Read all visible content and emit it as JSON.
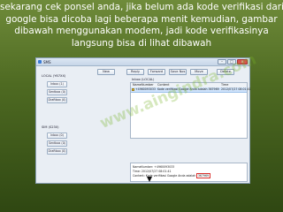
{
  "caption": {
    "line1": "sekarang cek ponsel anda, jika belum ada kode verifikasi dari",
    "line2": "google bisa dicoba lagi beberapa menit kemudian, gambar",
    "line3": "dibawah menggunakan modem, jadi kode verifikasinya",
    "line4": "langsung bisa di lihat dibawah"
  },
  "window": {
    "title": "SMS",
    "controls": {
      "min": "–",
      "max": "□",
      "close": "×"
    }
  },
  "toolbar": {
    "buttons": [
      "New",
      "Reply",
      "Forward",
      "Save Nos",
      "Move",
      "Delete"
    ]
  },
  "sidebar": {
    "local_label": "LOCAL (Y67XX)",
    "sim_label": "SIM (S230)",
    "local_items": [
      "Inbox (1)",
      "Sentbox (0)",
      "Draftbox (0)"
    ],
    "sim_items": [
      "Inbox (0)",
      "Sentbox (0)",
      "Draftbox (0)"
    ]
  },
  "inbox": {
    "label": "Inbox (LOCAL)",
    "columns": [
      "NameNumber",
      "Content",
      "Time"
    ],
    "rows": [
      {
        "number": "+4960093033",
        "content": "Kode verifikasi Google Anda adalah 367969",
        "time": "2012/07/27 08:01:41"
      }
    ]
  },
  "detail": {
    "line1": "NameNumber: +4960093033",
    "line2": "Time: 2012/07/27 08:01:41",
    "line3_prefix": "Content:   Kode verifikasi Google Anda adalah ",
    "code": "367969"
  },
  "watermark": "www.aingindra.com",
  "colors": {
    "accent_red": "#d9302c",
    "selection": "#cfe3fb"
  }
}
